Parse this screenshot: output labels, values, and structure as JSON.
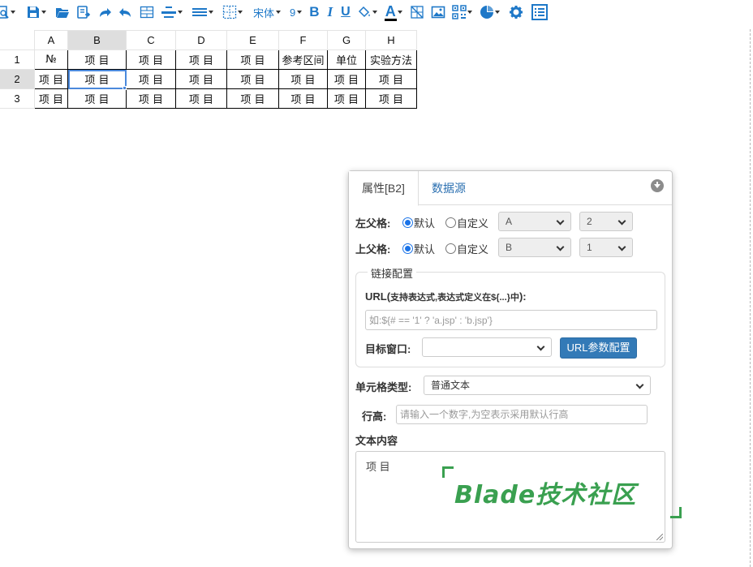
{
  "toolbar": {
    "font_name": "宋体",
    "font_size": "9",
    "bold_label": "B",
    "italic_label": "I",
    "underline_label": "U",
    "font_color_label": "A",
    "colors": {
      "icon": "#1e78c8",
      "font_color_bar": "#000000"
    }
  },
  "sheet": {
    "columns": [
      "A",
      "B",
      "C",
      "D",
      "E",
      "F",
      "G",
      "H"
    ],
    "rows": [
      {
        "num": "1",
        "cells": [
          "№",
          "项 目",
          "项 目",
          "项 目",
          "项 目",
          "参考区间",
          "单位",
          "实验方法"
        ]
      },
      {
        "num": "2",
        "cells": [
          "项 目",
          "项 目",
          "项 目",
          "项 目",
          "项 目",
          "项 目",
          "项 目",
          "项 目"
        ]
      },
      {
        "num": "3",
        "cells": [
          "项 目",
          "项 目",
          "项 目",
          "项 目",
          "项 目",
          "项 目",
          "项 目",
          "项 目"
        ]
      }
    ],
    "selected_cell": "B2"
  },
  "panel": {
    "tab_properties": "属性[B2]",
    "tab_datasource": "数据源",
    "left_parent": {
      "label": "左父格:",
      "opt_default": "默认",
      "opt_custom": "自定义",
      "col_value": "A",
      "row_value": "2"
    },
    "top_parent": {
      "label": "上父格:",
      "opt_default": "默认",
      "opt_custom": "自定义",
      "col_value": "B",
      "row_value": "1"
    },
    "link": {
      "legend": "链接配置",
      "url_label": "URL(",
      "url_hint": "支持表达式,表达式定义在${...}中",
      "url_label_end": "):",
      "url_placeholder": "如:${# == '1' ? 'a.jsp' : 'b.jsp'}",
      "target_label": "目标窗口:",
      "target_value": "",
      "param_button": "URL参数配置"
    },
    "cell_type": {
      "label": "单元格类型:",
      "value": "普通文本"
    },
    "row_height": {
      "label": "行高:",
      "placeholder": "请输入一个数字,为空表示采用默认行高"
    },
    "text_content": {
      "label": "文本内容",
      "value": "项 目"
    }
  },
  "watermark": {
    "text": "Blade技术社区",
    "color": "#3aa050"
  }
}
